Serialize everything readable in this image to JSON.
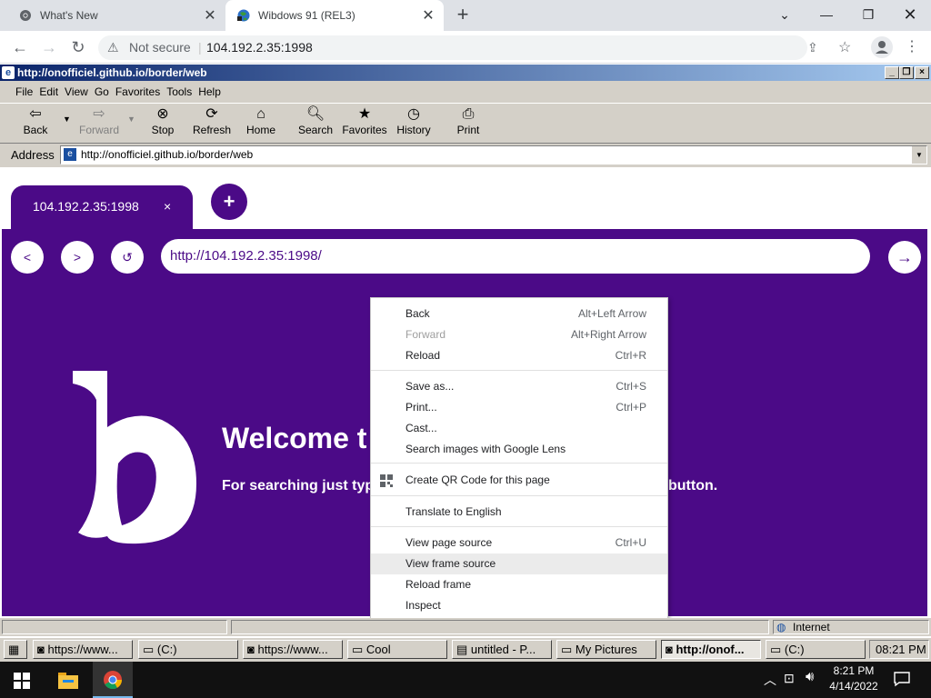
{
  "chrome": {
    "tabs": [
      {
        "title": "What's New",
        "icon": "chrome-icon"
      },
      {
        "title": "Wibdows 91 (REL3)",
        "icon": "globe-icon"
      }
    ],
    "new_tab": "+",
    "security": "Not secure",
    "url": "104.192.2.35:1998"
  },
  "ie": {
    "title": "http://onofficiel.github.io/border/web",
    "menu": [
      "File",
      "Edit",
      "View",
      "Go",
      "Favorites",
      "Tools",
      "Help"
    ],
    "toolbar": [
      "Back",
      "Forward",
      "Stop",
      "Refresh",
      "Home",
      "Search",
      "Favorites",
      "History",
      "Print"
    ],
    "address_label": "Address",
    "address": "http://onofficiel.github.io/border/web",
    "status_zone": "Internet"
  },
  "webpage": {
    "tab_title": "104.192.2.35:1998",
    "tab_close": "×",
    "plus": "+",
    "back": "<",
    "forward": ">",
    "reload": "↺",
    "url": "http://104.192.2.35:1998/",
    "go": "→",
    "heading": "Welcome t",
    "subtext": "For searching just typ",
    "subtext_tail": "button."
  },
  "context_menu": [
    {
      "label": "Back",
      "shortcut": "Alt+Left Arrow",
      "disabled": false
    },
    {
      "label": "Forward",
      "shortcut": "Alt+Right Arrow",
      "disabled": true
    },
    {
      "label": "Reload",
      "shortcut": "Ctrl+R",
      "disabled": false
    },
    {
      "label": "Save as...",
      "shortcut": "Ctrl+S",
      "disabled": false
    },
    {
      "label": "Print...",
      "shortcut": "Ctrl+P",
      "disabled": false
    },
    {
      "label": "Cast...",
      "shortcut": "",
      "disabled": false
    },
    {
      "label": "Search images with Google Lens",
      "shortcut": "",
      "disabled": false
    },
    {
      "label": "Create QR Code for this page",
      "shortcut": "",
      "disabled": false
    },
    {
      "label": "Translate to English",
      "shortcut": "",
      "disabled": false
    },
    {
      "label": "View page source",
      "shortcut": "Ctrl+U",
      "disabled": false
    },
    {
      "label": "View frame source",
      "shortcut": "",
      "disabled": false,
      "hovered": true
    },
    {
      "label": "Reload frame",
      "shortcut": "",
      "disabled": false
    },
    {
      "label": "Inspect",
      "shortcut": "",
      "disabled": false
    }
  ],
  "xp_taskbar": {
    "items": [
      "https://www...",
      "(C:)",
      "https://www...",
      "Cool",
      "untitled - P...",
      "My Pictures",
      "http://onof...",
      "(C:)"
    ],
    "clock": "08:21 PM"
  },
  "win10": {
    "time": "8:21 PM",
    "date": "4/14/2022"
  },
  "colors": {
    "purple": "#4b0a87",
    "xp_title": "#0a246a",
    "xp_face": "#d4d0c8"
  }
}
